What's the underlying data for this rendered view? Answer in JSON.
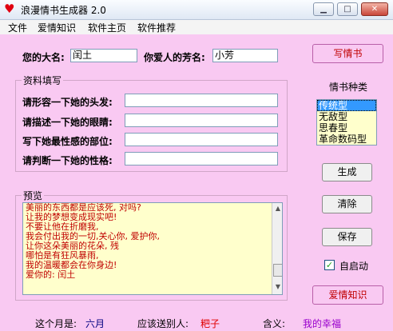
{
  "window": {
    "title": "浪漫情书生成器 2.0",
    "minimize_glyph": "▁",
    "maximize_glyph": "□",
    "close_glyph": "✕"
  },
  "menu": [
    "文件",
    "爱情知识",
    "软件主页",
    "软件推荐"
  ],
  "form": {
    "your_name_label": "您的大名:",
    "your_name_value": "闰土",
    "lover_name_label": "你爱人的芳名:",
    "lover_name_value": "小芳",
    "info_group_label": "资料填写",
    "hair_label": "请形容一下她的头发:",
    "hair_value": "",
    "eyes_label": "请描述一下她的眼睛:",
    "eyes_value": "",
    "sexy_label": "写下她最性感的部位:",
    "sexy_value": "",
    "personality_label": "请判断一下她的性格:",
    "personality_value": ""
  },
  "preview": {
    "group_label": "预览",
    "lines": [
      "美丽的东西都是应该死, 对吗?",
      "让我的梦想变成现实吧!",
      "不要让他在折磨我,",
      "我会付出我的一切,关心你, 爱护你,",
      "让你这朵美丽的花朵, 残",
      "哪怕是有狂风暴雨,",
      "我的温暖都会在你身边!",
      "                       爱你的: 闰土"
    ]
  },
  "side": {
    "write_button": "写情书",
    "type_label": "情书种类",
    "types": [
      "传统型",
      "无敌型",
      "思春型",
      "革命数码型"
    ],
    "selected_type": "传统型",
    "generate_button": "生成",
    "clear_button": "清除",
    "save_button": "保存",
    "autostart_label": "自启动",
    "autostart_checked": true,
    "knowledge_button": "爱情知识"
  },
  "status": {
    "month_label": "这个月是:",
    "month_value": "六月",
    "gift_label": "应该送别人:",
    "gift_value": "粑子",
    "meaning_label": "含义:",
    "meaning_value": "我的幸福"
  },
  "colors": {
    "background": "#f9c9f2",
    "accent_red": "#c00000",
    "status_blue": "#000080",
    "status_red": "#e00000",
    "list_background": "#ffffcc"
  }
}
